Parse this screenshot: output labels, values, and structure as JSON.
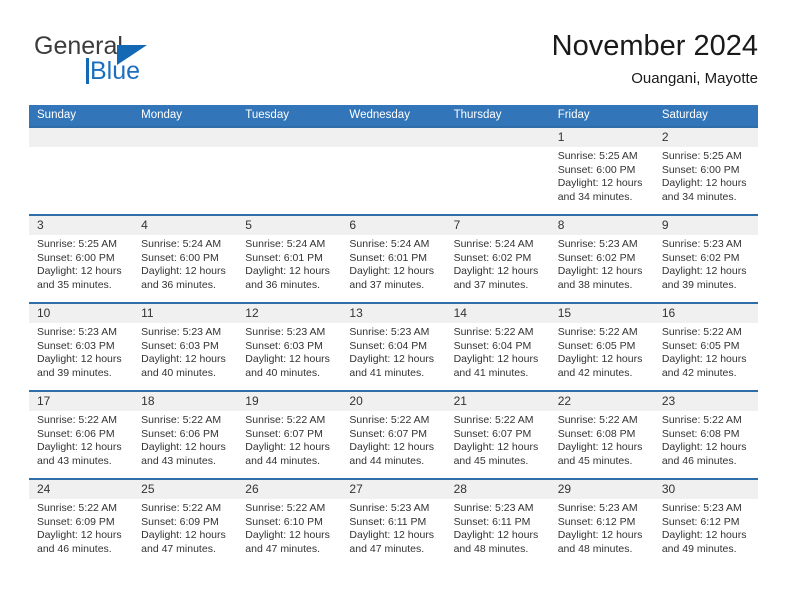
{
  "logo": {
    "text_top": "General",
    "text_bottom": "Blue",
    "triangle_icon": "blue-triangle-icon",
    "brand_color": "#1469b4"
  },
  "header": {
    "title": "November 2024",
    "subtitle": "Ouangani, Mayotte"
  },
  "colors": {
    "header_blue": "#3275b8",
    "row_divider_blue": "#2e6da8",
    "day_strip_gray": "#f0f0f0",
    "text": "#333333"
  },
  "calendar": {
    "weekday_headers": [
      "Sunday",
      "Monday",
      "Tuesday",
      "Wednesday",
      "Thursday",
      "Friday",
      "Saturday"
    ],
    "weeks": [
      [
        {
          "day": "",
          "empty": true,
          "sunrise": "",
          "sunset": "",
          "daylight_line1": "",
          "daylight_line2": ""
        },
        {
          "day": "",
          "empty": true,
          "sunrise": "",
          "sunset": "",
          "daylight_line1": "",
          "daylight_line2": ""
        },
        {
          "day": "",
          "empty": true,
          "sunrise": "",
          "sunset": "",
          "daylight_line1": "",
          "daylight_line2": ""
        },
        {
          "day": "",
          "empty": true,
          "sunrise": "",
          "sunset": "",
          "daylight_line1": "",
          "daylight_line2": ""
        },
        {
          "day": "",
          "empty": true,
          "sunrise": "",
          "sunset": "",
          "daylight_line1": "",
          "daylight_line2": ""
        },
        {
          "day": "1",
          "empty": false,
          "sunrise": "Sunrise: 5:25 AM",
          "sunset": "Sunset: 6:00 PM",
          "daylight_line1": "Daylight: 12 hours",
          "daylight_line2": "and 34 minutes."
        },
        {
          "day": "2",
          "empty": false,
          "sunrise": "Sunrise: 5:25 AM",
          "sunset": "Sunset: 6:00 PM",
          "daylight_line1": "Daylight: 12 hours",
          "daylight_line2": "and 34 minutes."
        }
      ],
      [
        {
          "day": "3",
          "empty": false,
          "sunrise": "Sunrise: 5:25 AM",
          "sunset": "Sunset: 6:00 PM",
          "daylight_line1": "Daylight: 12 hours",
          "daylight_line2": "and 35 minutes."
        },
        {
          "day": "4",
          "empty": false,
          "sunrise": "Sunrise: 5:24 AM",
          "sunset": "Sunset: 6:00 PM",
          "daylight_line1": "Daylight: 12 hours",
          "daylight_line2": "and 36 minutes."
        },
        {
          "day": "5",
          "empty": false,
          "sunrise": "Sunrise: 5:24 AM",
          "sunset": "Sunset: 6:01 PM",
          "daylight_line1": "Daylight: 12 hours",
          "daylight_line2": "and 36 minutes."
        },
        {
          "day": "6",
          "empty": false,
          "sunrise": "Sunrise: 5:24 AM",
          "sunset": "Sunset: 6:01 PM",
          "daylight_line1": "Daylight: 12 hours",
          "daylight_line2": "and 37 minutes."
        },
        {
          "day": "7",
          "empty": false,
          "sunrise": "Sunrise: 5:24 AM",
          "sunset": "Sunset: 6:02 PM",
          "daylight_line1": "Daylight: 12 hours",
          "daylight_line2": "and 37 minutes."
        },
        {
          "day": "8",
          "empty": false,
          "sunrise": "Sunrise: 5:23 AM",
          "sunset": "Sunset: 6:02 PM",
          "daylight_line1": "Daylight: 12 hours",
          "daylight_line2": "and 38 minutes."
        },
        {
          "day": "9",
          "empty": false,
          "sunrise": "Sunrise: 5:23 AM",
          "sunset": "Sunset: 6:02 PM",
          "daylight_line1": "Daylight: 12 hours",
          "daylight_line2": "and 39 minutes."
        }
      ],
      [
        {
          "day": "10",
          "empty": false,
          "sunrise": "Sunrise: 5:23 AM",
          "sunset": "Sunset: 6:03 PM",
          "daylight_line1": "Daylight: 12 hours",
          "daylight_line2": "and 39 minutes."
        },
        {
          "day": "11",
          "empty": false,
          "sunrise": "Sunrise: 5:23 AM",
          "sunset": "Sunset: 6:03 PM",
          "daylight_line1": "Daylight: 12 hours",
          "daylight_line2": "and 40 minutes."
        },
        {
          "day": "12",
          "empty": false,
          "sunrise": "Sunrise: 5:23 AM",
          "sunset": "Sunset: 6:03 PM",
          "daylight_line1": "Daylight: 12 hours",
          "daylight_line2": "and 40 minutes."
        },
        {
          "day": "13",
          "empty": false,
          "sunrise": "Sunrise: 5:23 AM",
          "sunset": "Sunset: 6:04 PM",
          "daylight_line1": "Daylight: 12 hours",
          "daylight_line2": "and 41 minutes."
        },
        {
          "day": "14",
          "empty": false,
          "sunrise": "Sunrise: 5:22 AM",
          "sunset": "Sunset: 6:04 PM",
          "daylight_line1": "Daylight: 12 hours",
          "daylight_line2": "and 41 minutes."
        },
        {
          "day": "15",
          "empty": false,
          "sunrise": "Sunrise: 5:22 AM",
          "sunset": "Sunset: 6:05 PM",
          "daylight_line1": "Daylight: 12 hours",
          "daylight_line2": "and 42 minutes."
        },
        {
          "day": "16",
          "empty": false,
          "sunrise": "Sunrise: 5:22 AM",
          "sunset": "Sunset: 6:05 PM",
          "daylight_line1": "Daylight: 12 hours",
          "daylight_line2": "and 42 minutes."
        }
      ],
      [
        {
          "day": "17",
          "empty": false,
          "sunrise": "Sunrise: 5:22 AM",
          "sunset": "Sunset: 6:06 PM",
          "daylight_line1": "Daylight: 12 hours",
          "daylight_line2": "and 43 minutes."
        },
        {
          "day": "18",
          "empty": false,
          "sunrise": "Sunrise: 5:22 AM",
          "sunset": "Sunset: 6:06 PM",
          "daylight_line1": "Daylight: 12 hours",
          "daylight_line2": "and 43 minutes."
        },
        {
          "day": "19",
          "empty": false,
          "sunrise": "Sunrise: 5:22 AM",
          "sunset": "Sunset: 6:07 PM",
          "daylight_line1": "Daylight: 12 hours",
          "daylight_line2": "and 44 minutes."
        },
        {
          "day": "20",
          "empty": false,
          "sunrise": "Sunrise: 5:22 AM",
          "sunset": "Sunset: 6:07 PM",
          "daylight_line1": "Daylight: 12 hours",
          "daylight_line2": "and 44 minutes."
        },
        {
          "day": "21",
          "empty": false,
          "sunrise": "Sunrise: 5:22 AM",
          "sunset": "Sunset: 6:07 PM",
          "daylight_line1": "Daylight: 12 hours",
          "daylight_line2": "and 45 minutes."
        },
        {
          "day": "22",
          "empty": false,
          "sunrise": "Sunrise: 5:22 AM",
          "sunset": "Sunset: 6:08 PM",
          "daylight_line1": "Daylight: 12 hours",
          "daylight_line2": "and 45 minutes."
        },
        {
          "day": "23",
          "empty": false,
          "sunrise": "Sunrise: 5:22 AM",
          "sunset": "Sunset: 6:08 PM",
          "daylight_line1": "Daylight: 12 hours",
          "daylight_line2": "and 46 minutes."
        }
      ],
      [
        {
          "day": "24",
          "empty": false,
          "sunrise": "Sunrise: 5:22 AM",
          "sunset": "Sunset: 6:09 PM",
          "daylight_line1": "Daylight: 12 hours",
          "daylight_line2": "and 46 minutes."
        },
        {
          "day": "25",
          "empty": false,
          "sunrise": "Sunrise: 5:22 AM",
          "sunset": "Sunset: 6:09 PM",
          "daylight_line1": "Daylight: 12 hours",
          "daylight_line2": "and 47 minutes."
        },
        {
          "day": "26",
          "empty": false,
          "sunrise": "Sunrise: 5:22 AM",
          "sunset": "Sunset: 6:10 PM",
          "daylight_line1": "Daylight: 12 hours",
          "daylight_line2": "and 47 minutes."
        },
        {
          "day": "27",
          "empty": false,
          "sunrise": "Sunrise: 5:23 AM",
          "sunset": "Sunset: 6:11 PM",
          "daylight_line1": "Daylight: 12 hours",
          "daylight_line2": "and 47 minutes."
        },
        {
          "day": "28",
          "empty": false,
          "sunrise": "Sunrise: 5:23 AM",
          "sunset": "Sunset: 6:11 PM",
          "daylight_line1": "Daylight: 12 hours",
          "daylight_line2": "and 48 minutes."
        },
        {
          "day": "29",
          "empty": false,
          "sunrise": "Sunrise: 5:23 AM",
          "sunset": "Sunset: 6:12 PM",
          "daylight_line1": "Daylight: 12 hours",
          "daylight_line2": "and 48 minutes."
        },
        {
          "day": "30",
          "empty": false,
          "sunrise": "Sunrise: 5:23 AM",
          "sunset": "Sunset: 6:12 PM",
          "daylight_line1": "Daylight: 12 hours",
          "daylight_line2": "and 49 minutes."
        }
      ]
    ]
  }
}
